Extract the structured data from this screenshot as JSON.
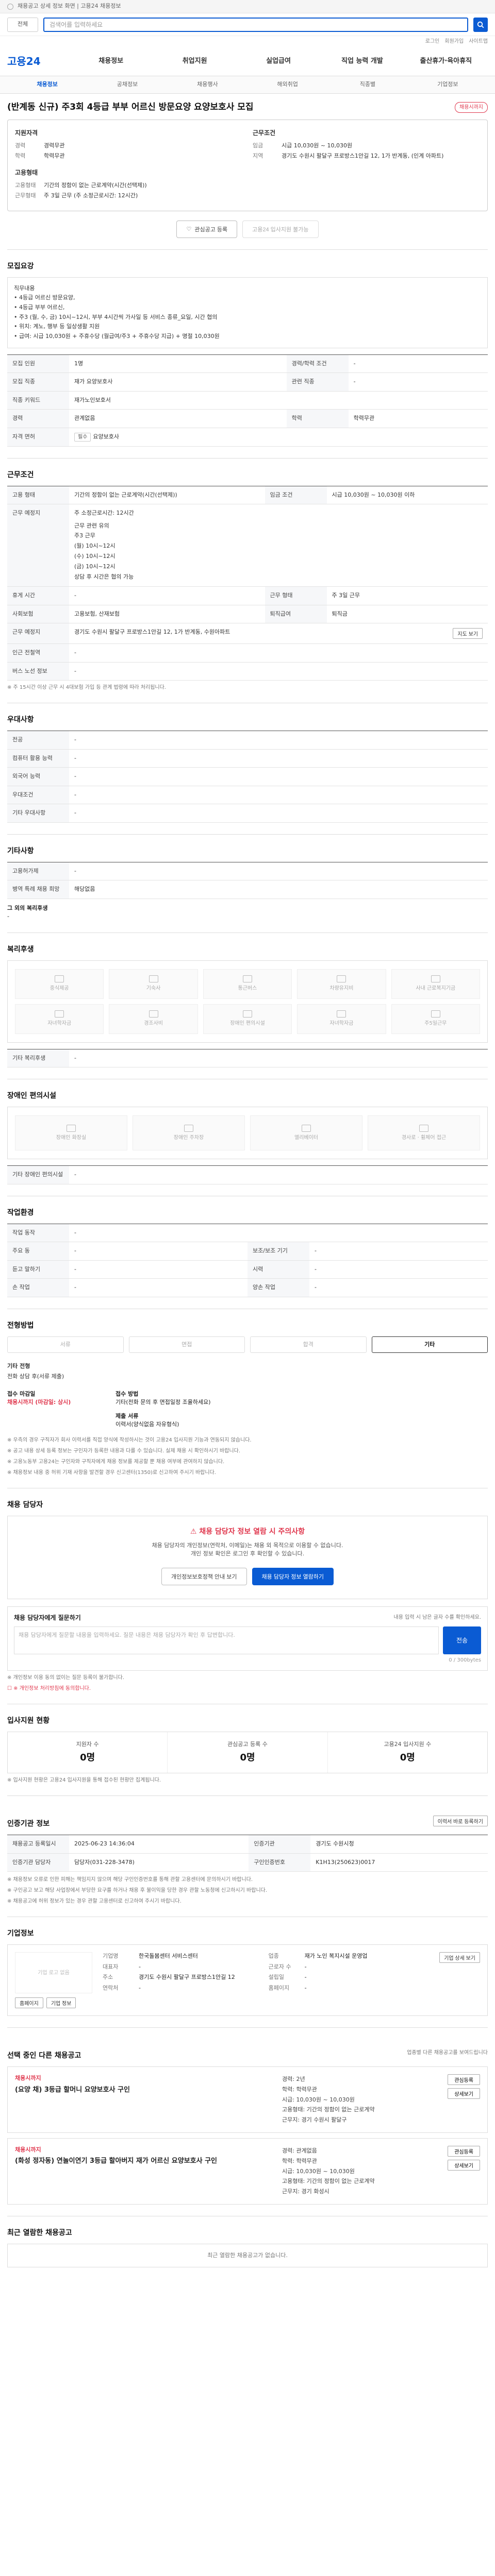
{
  "top": {
    "notice": "채용공고 상세 정보 화면 | 고용24 채용정보",
    "search_select": "전체",
    "search_placeholder": "검색어를 입력하세요",
    "util": [
      "로그인",
      "회원가입",
      "사이트맵"
    ]
  },
  "gnb": {
    "logo": "고용24",
    "items": [
      "채용정보",
      "취업지원",
      "실업급여",
      "직업 능력 개발",
      "출산휴가·육아휴직"
    ]
  },
  "lnb": {
    "items": [
      "채용정보",
      "공채정보",
      "채용행사",
      "해외취업",
      "직종별",
      "기업정보"
    ]
  },
  "job": {
    "title": "(반계동 신규) 주3회 4등급 부부 어르신 방문요양 요양보호사 모집",
    "badge": "채용시까지",
    "summary": {
      "left_h": "지원자격",
      "left": [
        {
          "k": "경력",
          "v": "경력무관"
        },
        {
          "k": "학력",
          "v": "학력무관"
        }
      ],
      "left_h2": "고용형태",
      "left2": [
        {
          "k": "고용형태",
          "v": "기간의 정함이 없는 근로계약(시간(선택제))"
        },
        {
          "k": "근무형태",
          "v": "주 3일 근무 (주 소정근로시간: 12시간)"
        }
      ],
      "right_h": "근무조건",
      "right": [
        {
          "k": "임금",
          "v": "시급 10,030원 ~ 10,030원"
        },
        {
          "k": "지역",
          "v": "경기도 수원시 팔달구 프로방스1안길 12, 1가 반계동,   (인계 아파트)"
        }
      ]
    },
    "actions": {
      "scrap": "관심공고 등록",
      "apply": "고용24 입사지원 불가능"
    }
  },
  "s_desc": {
    "title": "모집요강",
    "body": [
      "직무내용",
      "• 4등급 어르신 방문요양,",
      "• 4등급 부부 어르신,",
      "• 주3 (월, 수, 금) 10시~12시, 부부 4시간씩 가사일 등 서비스 종류_요일, 시간 협의",
      "• 위치: 계노, 행부 등 일상생활 지원",
      "• 급여: 시급 10,030원 + 주휴수당 (월급여/주3 + 주휴수당 지급) + 명절 10,030원"
    ],
    "rows": [
      {
        "h": "모집 인원",
        "v": "1명",
        "h2": "경력/학력 조건",
        "v2": "-"
      },
      {
        "h": "모집 직종",
        "v": "재가 요양보호사",
        "h2": "관련 직종",
        "v2": "-"
      },
      {
        "h": "직종 키워드",
        "v": "재가노인보호서",
        "h2": "",
        "v2": ""
      },
      {
        "h": "경력",
        "v": "관계없음",
        "h2": "학력",
        "v2": "학력무관"
      },
      {
        "h": "자격 면허",
        "v": "요양보호사",
        "v_tag": "필수",
        "h2": "",
        "v2": ""
      }
    ]
  },
  "s_cond": {
    "title": "근무조건",
    "rows": [
      {
        "h": "고용 형태",
        "v": "기간의 정함이 없는 근로계약(시간(선택제))",
        "h2": "임금 조건",
        "v2": "시급 10,030원 ~ 10,030원 이하"
      },
      {
        "h": "근무 예정지",
        "v": "주 소정근로시간: 12시간",
        "h2": "",
        "v2": ""
      }
    ],
    "time_block": [
      "근무 관련 유의",
      "주3 근무",
      "(월) 10시~12시",
      "(수) 10시~12시",
      "(금) 10시~12시",
      "상담 후 시간은 협의 가능"
    ],
    "rows2": [
      {
        "h": "휴게 시간",
        "v": "-",
        "h2": "근무 형태",
        "v2": "주 3일 근무"
      },
      {
        "h": "사회보험",
        "v": "고용보험, 산재보험",
        "h2": "퇴직급여",
        "v2": "퇴직금"
      },
      {
        "h": "근무 예정지",
        "v": "경기도 수원시 팔달구 프로방스1안길 12, 1가 반계동, 수원아파트",
        "h2": "",
        "v2": ""
      },
      {
        "h": "인근 전철역",
        "v": "-",
        "h2": "",
        "v2": ""
      },
      {
        "h": "버스 노선 정보",
        "v": "-",
        "h2": "",
        "v2": ""
      }
    ],
    "map_btn": "지도 보기",
    "note": "※ 주 15시간 이상 근무 시 4대보험 가입 등 관계 법령에 따라 처리됩니다."
  },
  "s_pref": {
    "title": "우대사항",
    "rows": [
      {
        "h": "전공",
        "v": "-"
      },
      {
        "h": "컴퓨터 활용 능력",
        "v": "-"
      },
      {
        "h": "외국어 능력",
        "v": "-"
      },
      {
        "h": "우대조건",
        "v": "-"
      },
      {
        "h": "기타 우대사항",
        "v": "-"
      }
    ]
  },
  "s_etc": {
    "title": "기타사항",
    "rows": [
      {
        "h": "고용허가제",
        "v": "-"
      },
      {
        "h": "병역 특례 채용 희망",
        "v": "해당없음"
      }
    ],
    "extra_h": "그 외의 복리후생",
    "extra_v": "-"
  },
  "s_welfare": {
    "title": "복리후생",
    "items": [
      "중식제공",
      "기숙사",
      "통근버스",
      "차량유지비",
      "사내 근로복지기금",
      "자녀학자금",
      "경조사비",
      "장애인 편의시설",
      "자녀학자금",
      "주5일근무"
    ],
    "extra_h": "기타 복리후생",
    "extra_v": "-"
  },
  "s_disabled": {
    "title": "장애인 편의시설",
    "items": [
      "장애인 화장실",
      "장애인 주차장",
      "엘리베이터",
      "경사로 · 휠체어 접근"
    ],
    "extra_h": "기타 장애인 편의시설",
    "extra_v": "-"
  },
  "s_env": {
    "title": "작업환경",
    "rows": [
      {
        "h": "작업 동작",
        "v": "-",
        "h2": "",
        "v2": ""
      },
      {
        "h": "주요 동",
        "v": "-",
        "h2": "보조/보조 기기",
        "v2": "-"
      },
      {
        "h": "듣고 말하기",
        "v": "-",
        "h2": "시력",
        "v2": "-"
      },
      {
        "h": "손 작업",
        "v": "-",
        "h2": "양손 작업",
        "v2": "-"
      }
    ]
  },
  "s_process": {
    "title": "전형방법",
    "steps": [
      "서류",
      "면접",
      "합격",
      "기타"
    ],
    "method_h": "기타 전형",
    "method_v": "전화 상담 후(서류 제출)",
    "sub": [
      {
        "h": "접수 마감일",
        "v": "채용시까지 (마감일: 상시)"
      },
      {
        "h": "접수 방법",
        "v": "기타(전화 문의 후 면접일정 조율하세요)"
      },
      {
        "h": "제출 서류",
        "v": "이력서(양식없음 자유형식)"
      }
    ],
    "warn": [
      "※ 우측의 경우 구직자가 회사 이력서를 직접 양식에 작성하시는 것이 고용24 입사지원 기능과 연동되지 않습니다.",
      "※ 공고 내용 상세 등록 정보는 구인자가 등록한 내용과 다를 수 있습니다. 실제 채용 시 확인하시기 바랍니다.",
      "※ 고용노동부 고용24는 구인자와 구직자에게 채용 정보를 제공할 뿐 채용 여부에 관여하지 않습니다.",
      "※ 채용정보 내용 중 허위 기재 사항을 발견할 경우 신고센터(1350)로 신고하여 주시기 바랍니다."
    ]
  },
  "s_contact": {
    "title": "채용 담당자",
    "notice": "채용 담당자 정보 열람 시 주의사항",
    "desc": "채용 담당자의 개인정보(연락처, 이메일)는 채용 외 목적으로 이용할 수 없습니다.",
    "desc2": "개인 정보 확인은 로그인 후 확인할 수 있습니다.",
    "btn_a": "개인정보보호정책 안내 보기",
    "btn_b": "채용 담당자 정보 열람하기",
    "memo_h": "채용 담당자에게 질문하기",
    "memo_note": "내용 입력 시 남은 글자 수를 확인하세요.",
    "memo_placeholder": "채용 담당자에게 질문할 내용을 입력하세요. 질문 내용은 채용 담당자가 확인 후 답변합니다.",
    "memo_count": "0 / 300bytes",
    "memo_btn": "전송",
    "memo_foot1": "※ 개인정보 이용 동의 없이는 질문 등록이 불가합니다.",
    "memo_foot2": "※ 개인정보 처리방침에 동의합니다."
  },
  "s_apply": {
    "title": "입사지원 현황",
    "stats": [
      {
        "label": "지원자 수",
        "n": "0명"
      },
      {
        "label": "관심공고 등록 수",
        "n": "0명"
      },
      {
        "label": "고용24 입사지원 수",
        "n": "0명"
      }
    ],
    "note": "※ 입사지원 현황은 고용24 입사지원을 통해 접수된 현황만 집계됩니다."
  },
  "s_reg": {
    "title": "인증기관 정보",
    "btn": "이력서 바로 등록하기",
    "rows": [
      {
        "h": "채용공고 등록일시",
        "v": "2025-06-23 14:36:04",
        "h2": "인증기관",
        "v2": "경기도 수원시청"
      },
      {
        "h": "인증기관 담당자",
        "v": "담당자(031-228-3478)",
        "h2": "구인인증번호",
        "v2": "K1H13(250623)0017"
      }
    ],
    "warn": [
      "※ 채용정보 오류로 인한 피해는 책임지지 않으며 해당 구인인증번호를 통해 관할 고용센터에 문의하시기 바랍니다.",
      "※ 구인공고 보고 해당 사업장에서 부당한 요구를 하거나 채용 후 불이익을 당한 경우 관할 노동청에 신고하시기 바랍니다.",
      "※ 채용공고에 허위 정보가 있는 경우 관할 고용센터로 신고하여 주시기 바랍니다."
    ]
  },
  "s_company": {
    "title": "기업정보",
    "logo": "기업 로고 없음",
    "links": [
      "홈페이지",
      "기업 정보"
    ],
    "rows": [
      {
        "k": "기업명",
        "v": "한국돌봄센터 서비스센터",
        "k2": "업종",
        "v2": "재가 노인 복지시설 운영업"
      },
      {
        "k": "대표자",
        "v": "-",
        "k2": "근로자 수",
        "v2": "-"
      },
      {
        "k": "주소",
        "v": "경기도 수원시 팔달구 프로방스1안길 12",
        "k2": "설립일",
        "v2": "-"
      },
      {
        "k": "연락처",
        "v": "-",
        "k2": "홈페이지",
        "v2": "-"
      }
    ],
    "detail_btn": "기업 상세 보기"
  },
  "s_others": {
    "title": "선택 중인 다른 채용공고",
    "note": "업종별 다른 채용공고를 보여드립니다",
    "cards": [
      {
        "org": "채용시까지",
        "title": "(요양 채) 3등급 할머니 요양보호사 구인",
        "cond": [
          "경력: 2년",
          "학력: 학력무관",
          "시급: 10,030원 ~ 10,030원",
          "고용형태: 기간의 정함이 없는 근로계약",
          "근무지: 경기 수원시 팔달구"
        ],
        "side": [
          "관심등록",
          "상세보기"
        ]
      },
      {
        "org": "채용시까지",
        "title": "(화성 정자동) 연놀이연기 3등급 할아버지 재가 어르신 요양보호사 구인",
        "cond": [
          "경력: 관계없음",
          "학력: 학력무관",
          "시급: 10,030원 ~ 10,030원",
          "고용형태: 기간의 정함이 없는 근로계약",
          "근무지: 경기 화성시"
        ],
        "side": [
          "관심등록",
          "상세보기"
        ]
      }
    ]
  },
  "s_recent": {
    "title": "최근 열람한 채용공고",
    "empty": "최근 열람한 채용공고가 없습니다."
  }
}
